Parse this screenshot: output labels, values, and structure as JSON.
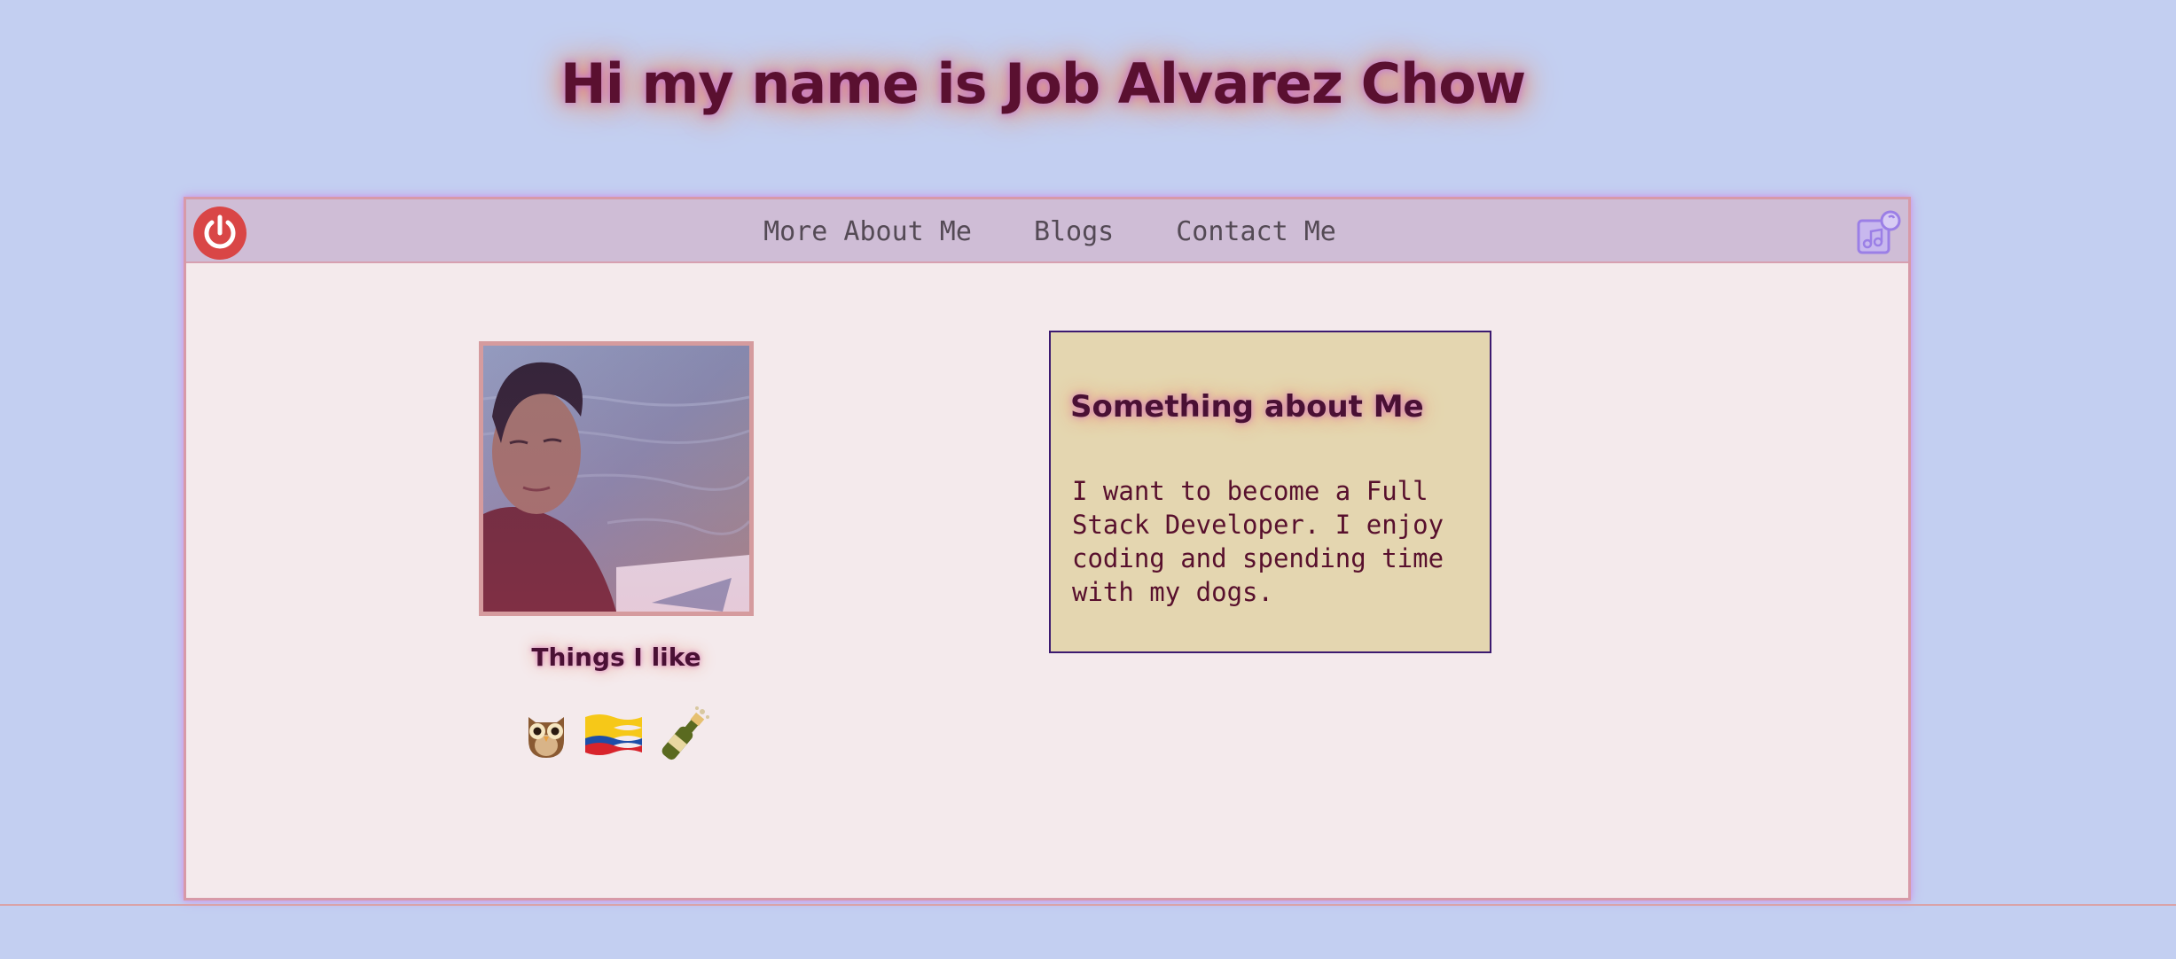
{
  "header": {
    "title": "Hi my name is Job Alvarez Chow"
  },
  "nav": {
    "links": [
      "More About Me",
      "Blogs",
      "Contact Me"
    ],
    "power_icon": "power-icon",
    "music_icon": "music-icon"
  },
  "profile": {
    "likes_title": "Things I like",
    "likes": [
      "🦉",
      "🇨🇴",
      "🍾"
    ]
  },
  "about": {
    "title": "Something about Me",
    "text": "I want to become a Full Stack Developer. I enjoy coding and spending time with my dogs."
  },
  "colors": {
    "background": "#c3cff1",
    "window": "#f4eaec",
    "navbar": "#cfbdd6",
    "card": "#e4d6b0",
    "title": "#5a1030",
    "power": "#d94646",
    "music": "#9b7fe6"
  }
}
